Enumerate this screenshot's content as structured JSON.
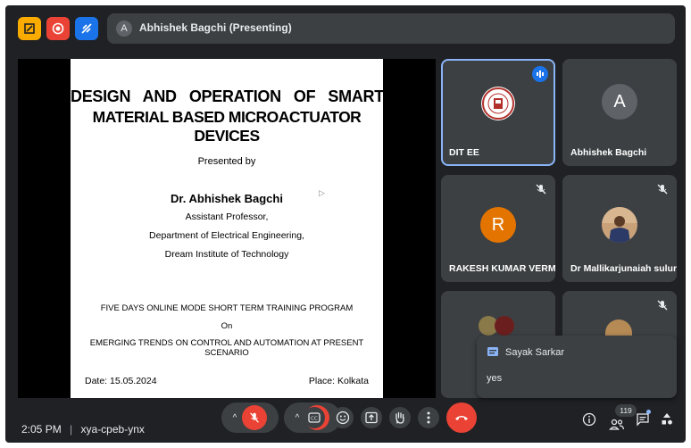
{
  "header": {
    "presenter_initial": "A",
    "presenter_label": "Abhishek Bagchi (Presenting)"
  },
  "slide": {
    "title_line1": "DESIGN   AND   OPERATION   OF   SMART",
    "title_line2": "MATERIAL BASED MICROACTUATOR DEVICES",
    "presented_by": "Presented by",
    "author": "Dr. Abhishek Bagchi",
    "designation": "Assistant Professor,",
    "department": "Department of Electrical Engineering,",
    "institute": "Dream Institute of Technology",
    "program_line1": "FIVE DAYS ONLINE MODE SHORT TERM TRAINING PROGRAM",
    "program_line2": "On",
    "program_line3": "EMERGING TRENDS ON CONTROL AND AUTOMATION AT PRESENT SCENARIO",
    "date": "Date: 15.05.2024",
    "place": "Place: Kolkata"
  },
  "participants": [
    {
      "name": "DIT EE",
      "avatar": "institute-logo",
      "speaking": true
    },
    {
      "name": "Abhishek Bagchi",
      "initial": "A"
    },
    {
      "name": "RAKESH KUMAR VERMA",
      "initial": "R",
      "muted": true
    },
    {
      "name": "Dr Mallikarjunaiah suluru",
      "avatar": "photo",
      "muted": true
    }
  ],
  "chat_popup": {
    "sender": "Sayak Sarkar",
    "message": "yes"
  },
  "footer": {
    "time": "2:05 PM",
    "separator": "|",
    "meeting_code": "xya-cpeb-ynx",
    "participant_count": "119"
  },
  "colors": {
    "background": "#202124",
    "tile": "#3c4043",
    "speaking_border": "#8ab4f8",
    "accent_blue": "#1a73e8",
    "end_call_red": "#ea4335",
    "avatar_orange": "#e37400",
    "avatar_gray": "#5f6368"
  }
}
